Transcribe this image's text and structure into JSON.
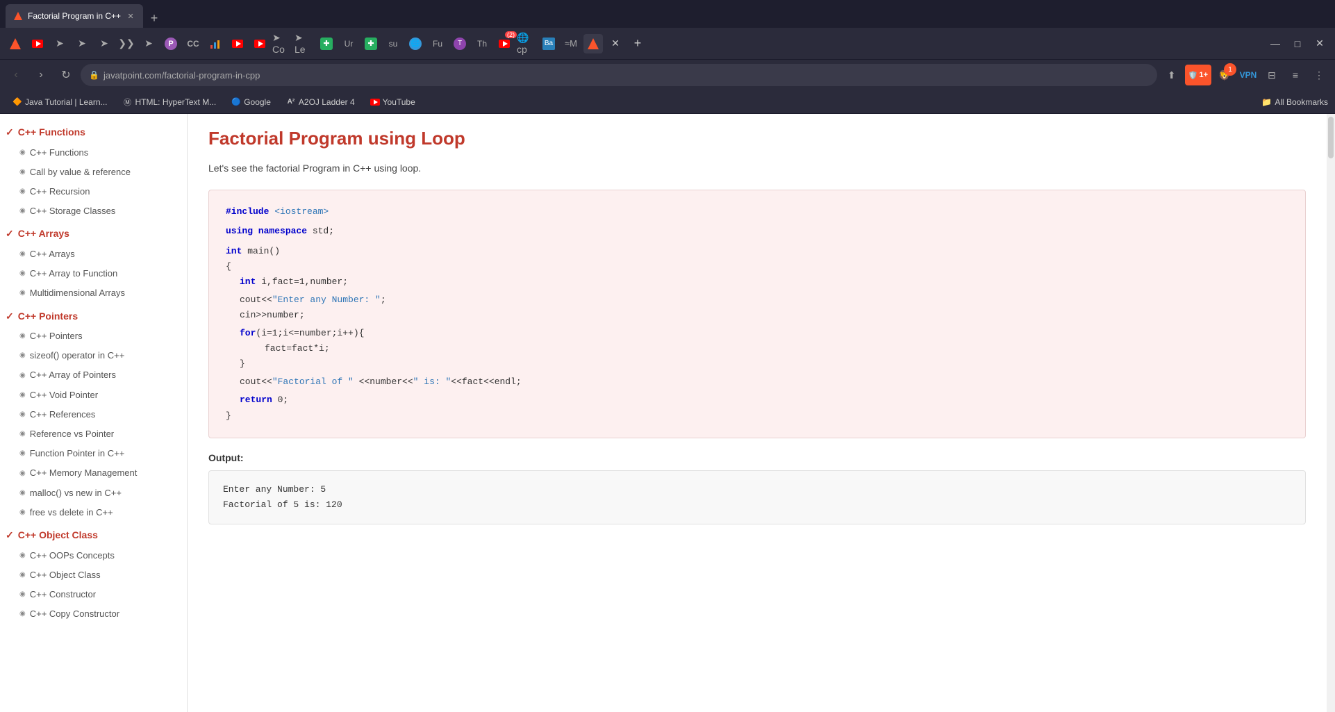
{
  "browser": {
    "tab": {
      "title": "Factorial Program in C++",
      "url_domain": "javatpoint.com",
      "url_path": "/factorial-program-in-cpp"
    },
    "bookmarks": [
      {
        "label": "Java Tutorial | Learn...",
        "icon": "🔶"
      },
      {
        "label": "HTML: HyperText M...",
        "icon": "Ⓜ"
      },
      {
        "label": "Google",
        "icon": "🔵"
      },
      {
        "label": "A2OJ Ladder 4",
        "icon": "A²"
      },
      {
        "label": "YouTube",
        "icon": "▶"
      }
    ],
    "bookmarks_right": "All Bookmarks"
  },
  "sidebar": {
    "items": [
      {
        "type": "category",
        "label": "C++ Functions",
        "check": true
      },
      {
        "type": "sub",
        "label": "C++ Functions"
      },
      {
        "type": "sub",
        "label": "Call by value & reference"
      },
      {
        "type": "sub",
        "label": "C++ Recursion"
      },
      {
        "type": "sub",
        "label": "C++ Storage Classes"
      },
      {
        "type": "category",
        "label": "C++ Arrays",
        "check": true
      },
      {
        "type": "sub",
        "label": "C++ Arrays"
      },
      {
        "type": "sub",
        "label": "C++ Array to Function"
      },
      {
        "type": "sub",
        "label": "Multidimensional Arrays"
      },
      {
        "type": "category",
        "label": "C++ Pointers",
        "check": true
      },
      {
        "type": "sub",
        "label": "C++ Pointers"
      },
      {
        "type": "sub",
        "label": "sizeof() operator in C++"
      },
      {
        "type": "sub",
        "label": "C++ Array of Pointers"
      },
      {
        "type": "sub",
        "label": "C++ Void Pointer"
      },
      {
        "type": "sub",
        "label": "C++ References"
      },
      {
        "type": "sub",
        "label": "Reference vs Pointer"
      },
      {
        "type": "sub",
        "label": "Function Pointer in C++"
      },
      {
        "type": "sub",
        "label": "C++ Memory Management"
      },
      {
        "type": "sub",
        "label": "malloc() vs new in C++"
      },
      {
        "type": "sub",
        "label": "free vs delete in C++"
      },
      {
        "type": "category",
        "label": "C++ Object Class",
        "check": true
      },
      {
        "type": "sub",
        "label": "C++ OOPs Concepts"
      },
      {
        "type": "sub",
        "label": "C++ Object Class"
      },
      {
        "type": "sub",
        "label": "C++ Constructor"
      },
      {
        "type": "sub",
        "label": "C++ Copy Constructor"
      }
    ]
  },
  "page": {
    "title": "Factorial Program using Loop",
    "description": "Let's see the factorial Program in C++ using loop.",
    "code_lines": [
      {
        "indent": 0,
        "parts": [
          {
            "type": "kw",
            "text": "#include "
          },
          {
            "type": "str",
            "text": "<iostream>"
          }
        ]
      },
      {
        "indent": 0,
        "parts": [
          {
            "type": "kw",
            "text": "using namespace "
          },
          {
            "type": "normal",
            "text": "std;"
          }
        ]
      },
      {
        "indent": 0,
        "parts": [
          {
            "type": "kw",
            "text": "int "
          },
          {
            "type": "normal",
            "text": "main()"
          }
        ]
      },
      {
        "indent": 0,
        "parts": [
          {
            "type": "normal",
            "text": "{"
          }
        ]
      },
      {
        "indent": 1,
        "parts": [
          {
            "type": "kw",
            "text": "int "
          },
          {
            "type": "normal",
            "text": "i,fact=1,number;"
          }
        ]
      },
      {
        "indent": 0,
        "parts": [
          {
            "type": "normal",
            "text": "    cout<<"
          },
          {
            "type": "str",
            "text": "\"Enter any Number: \""
          },
          {
            "type": "normal",
            "text": ";"
          }
        ]
      },
      {
        "indent": 0,
        "parts": [
          {
            "type": "normal",
            "text": "    cin>>number;"
          }
        ]
      },
      {
        "indent": 0,
        "parts": [
          {
            "type": "normal",
            "text": "    "
          },
          {
            "type": "kw",
            "text": "for"
          },
          {
            "type": "normal",
            "text": "(i=1;i<=number;i++){"
          }
        ]
      },
      {
        "indent": 2,
        "parts": [
          {
            "type": "normal",
            "text": "fact=fact*i;"
          }
        ]
      },
      {
        "indent": 1,
        "parts": [
          {
            "type": "normal",
            "text": "}"
          }
        ]
      },
      {
        "indent": 0,
        "parts": [
          {
            "type": "normal",
            "text": "    cout<<"
          },
          {
            "type": "str",
            "text": "\"Factorial of \""
          },
          {
            "type": "normal",
            "text": " <<number<<"
          },
          {
            "type": "str",
            "text": "\" is: \""
          },
          {
            "type": "normal",
            "text": "<<fact<<endl;"
          }
        ]
      },
      {
        "indent": 0,
        "parts": [
          {
            "type": "normal",
            "text": "    "
          },
          {
            "type": "kw",
            "text": "return "
          },
          {
            "type": "normal",
            "text": "0;"
          }
        ]
      },
      {
        "indent": 0,
        "parts": [
          {
            "type": "normal",
            "text": "}"
          }
        ]
      }
    ],
    "output_label": "Output:",
    "output_lines": [
      "Enter any Number: 5",
      "Factorial of 5 is: 120"
    ]
  }
}
